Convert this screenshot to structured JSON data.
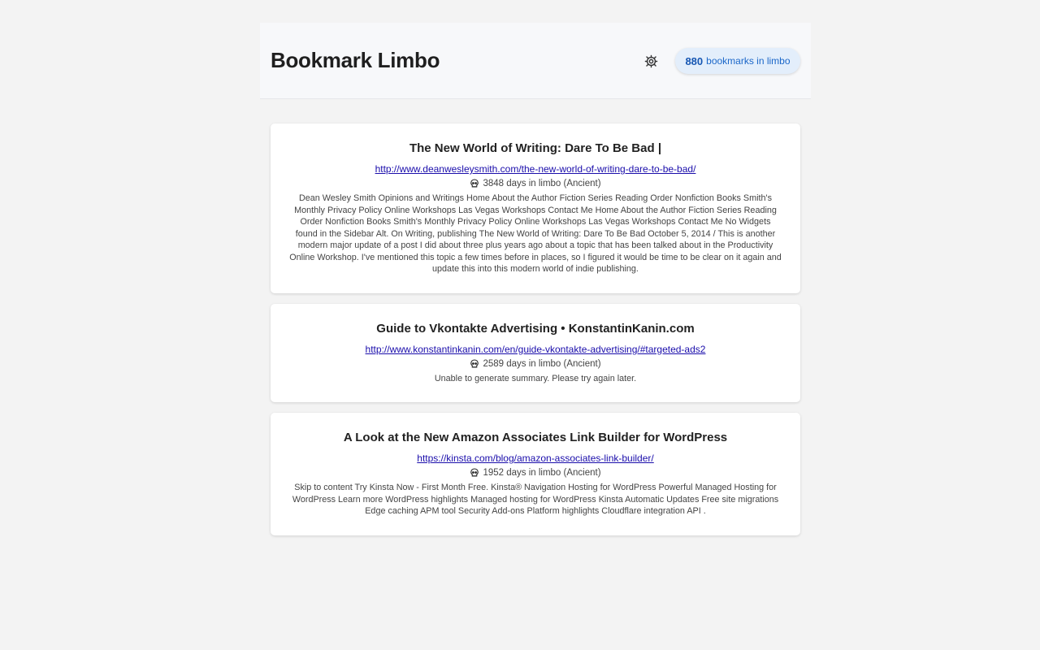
{
  "header": {
    "title": "Bookmark Limbo",
    "settings_icon": "gear-icon",
    "count": "880",
    "count_label": "bookmarks in limbo"
  },
  "colors": {
    "accent": "#1b67c9",
    "badge_bg": "#e3eefb",
    "link": "#1a0dab",
    "background": "#f3f3f3"
  },
  "bookmarks": [
    {
      "title": "The New World of Writing: Dare To Be Bad |",
      "url": "http://www.deanwesleysmith.com/the-new-world-of-writing-dare-to-be-bad/",
      "age_icon": "skull-icon",
      "age": "3848 days in limbo (Ancient)",
      "summary": "Dean Wesley Smith Opinions and Writings Home About the Author Fiction Series Reading Order Nonfiction Books Smith's Monthly Privacy Policy Online Workshops Las Vegas Workshops Contact Me Home About the Author Fiction Series Reading Order Nonfiction Books Smith's Monthly Privacy Policy Online Workshops Las Vegas Workshops Contact Me No Widgets found in the Sidebar Alt. On Writing,  publishing The New World of Writing: Dare To Be Bad October 5, 2014 / This is another modern major update of a post I did about three plus years ago about a topic that has been talked about in the Productivity Online Workshop. I've mentioned this topic a few times before in places, so I figured it would be time to be clear on it again and update this into this modern world of indie publishing."
    },
    {
      "title": "Guide to Vkontakte Advertising • KonstantinKanin.com",
      "url": "http://www.konstantinkanin.com/en/guide-vkontakte-advertising/#targeted-ads2",
      "age_icon": "skull-icon",
      "age": "2589 days in limbo (Ancient)",
      "summary": "Unable to generate summary. Please try again later."
    },
    {
      "title": "A Look at the New Amazon Associates Link Builder for WordPress",
      "url": "https://kinsta.com/blog/amazon-associates-link-builder/",
      "age_icon": "skull-icon",
      "age": "1952 days in limbo (Ancient)",
      "summary": "Skip to content Try Kinsta Now - First Month Free. Kinsta® Navigation Hosting for WordPress Powerful Managed Hosting for WordPress Learn more WordPress highlights Managed hosting for WordPress Kinsta Automatic Updates Free site migrations Edge caching APM tool Security Add-ons Platform highlights Cloudflare integration API ."
    }
  ]
}
